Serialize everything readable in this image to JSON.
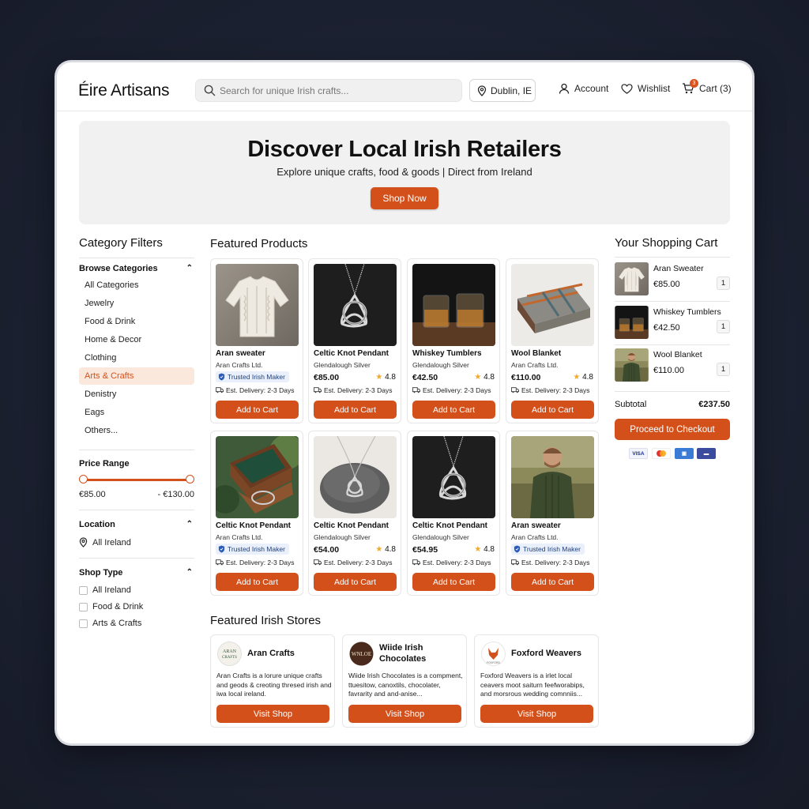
{
  "header": {
    "logo": "Éire Artisans",
    "search_placeholder": "Search for unique Irish crafts...",
    "location": "Dublin, IE",
    "account": "Account",
    "wishlist": "Wishlist",
    "cart": "Cart (3)",
    "cart_badge": "3"
  },
  "hero": {
    "title": "Discover Local Irish Retailers",
    "subtitle": "Explore unique crafts, food & goods | Direct from Ireland",
    "cta": "Shop Now"
  },
  "filters": {
    "title": "Category Filters",
    "browse_label": "Browse Categories",
    "categories": [
      "All Categories",
      "Jewelry",
      "Food & Drink",
      "Home & Decor",
      "Clothing",
      "Arts & Crafts",
      "Denistry",
      "Eags",
      "Others..."
    ],
    "active_category": "Arts & Crafts",
    "price_label": "Price Range",
    "price_min": "€85.00",
    "price_max": "- €130.00",
    "location_label": "Location",
    "location_value": "All Ireland",
    "shoptype_label": "Shop Type",
    "shoptypes": [
      "All Ireland",
      "Food & Drink",
      "Arts & Crafts"
    ]
  },
  "products": {
    "title": "Featured Products",
    "add_label": "Add to Cart",
    "trusted_label": "Trusted Irish Maker",
    "delivery": "Est. Delivery: 2-3 Days",
    "items": [
      {
        "name": "Aran sweater",
        "shop": "Aran Crafts Ltd.",
        "price": "",
        "rating": "",
        "trusted": true,
        "image": "sweater"
      },
      {
        "name": "Celtic Knot Pendant",
        "shop": "Glendalough Silver",
        "price": "€85.00",
        "rating": "4.8",
        "trusted": false,
        "image": "pendant"
      },
      {
        "name": "Whiskey Tumblers",
        "shop": "Glendalough Silver",
        "price": "€42.50",
        "rating": "4.8",
        "trusted": false,
        "image": "tumblers"
      },
      {
        "name": "Wool Blanket",
        "shop": "Aran Crafts Ltd.",
        "price": "€110.00",
        "rating": "4.8",
        "trusted": false,
        "image": "blanket"
      },
      {
        "name": "Celtic Knot Pendant",
        "shop": "Aran Crafts Ltd.",
        "price": "",
        "rating": "",
        "trusted": true,
        "image": "jewelbox"
      },
      {
        "name": "Celtic Knot Pendant",
        "shop": "Glendalough Silver",
        "price": "€54.00",
        "rating": "4.8",
        "trusted": false,
        "image": "stonependant"
      },
      {
        "name": "Celtic Knot Pendant",
        "shop": "Glendalough Silver",
        "price": "€54.95",
        "rating": "4.8",
        "trusted": false,
        "image": "pendant"
      },
      {
        "name": "Aran sweater",
        "shop": "Aran Crafts Ltd.",
        "price": "",
        "rating": "",
        "trusted": true,
        "image": "man"
      }
    ]
  },
  "cart": {
    "title": "Your Shopping Cart",
    "items": [
      {
        "name": "Aran Sweater",
        "price": "€85.00",
        "qty": "1",
        "image": "sweater"
      },
      {
        "name": "Whiskey Tumblers",
        "price": "€42.50",
        "qty": "1",
        "image": "tumblers"
      },
      {
        "name": "Wool Blanket",
        "price": "€110.00",
        "qty": "1",
        "image": "man"
      }
    ],
    "subtotal_label": "Subtotal",
    "subtotal": "€237.50",
    "checkout": "Proceed to Checkout",
    "payments": [
      "VISA",
      "MC",
      "AP",
      "BANK"
    ]
  },
  "stores": {
    "title": "Featured Irish Stores",
    "visit_label": "Visit Shop",
    "items": [
      {
        "name": "Aran Crafts",
        "logo_text": "ARAN CRAFTS",
        "desc": "Aran Crafts is a lorure unique crafts and geods & creoting thresed irish and iwa local ireland."
      },
      {
        "name": "Wiide Irish Chocolates",
        "logo_text": "WNLOE",
        "desc": "Wiide Irish Chocolates is a compment, ttuesitow, canoxtils, chocolater, favrarity and and-anise..."
      },
      {
        "name": "Foxford Weavers",
        "logo_text": "FOXFORD",
        "desc": "Foxford Weavers is a irlet local ceavers moot saiturn feefworabips, and morsrous wedding comnniis..."
      }
    ]
  },
  "colors": {
    "accent": "#d4501b",
    "hero_bg": "#f1f1f1",
    "trusted_bg": "#e9f0fb"
  }
}
